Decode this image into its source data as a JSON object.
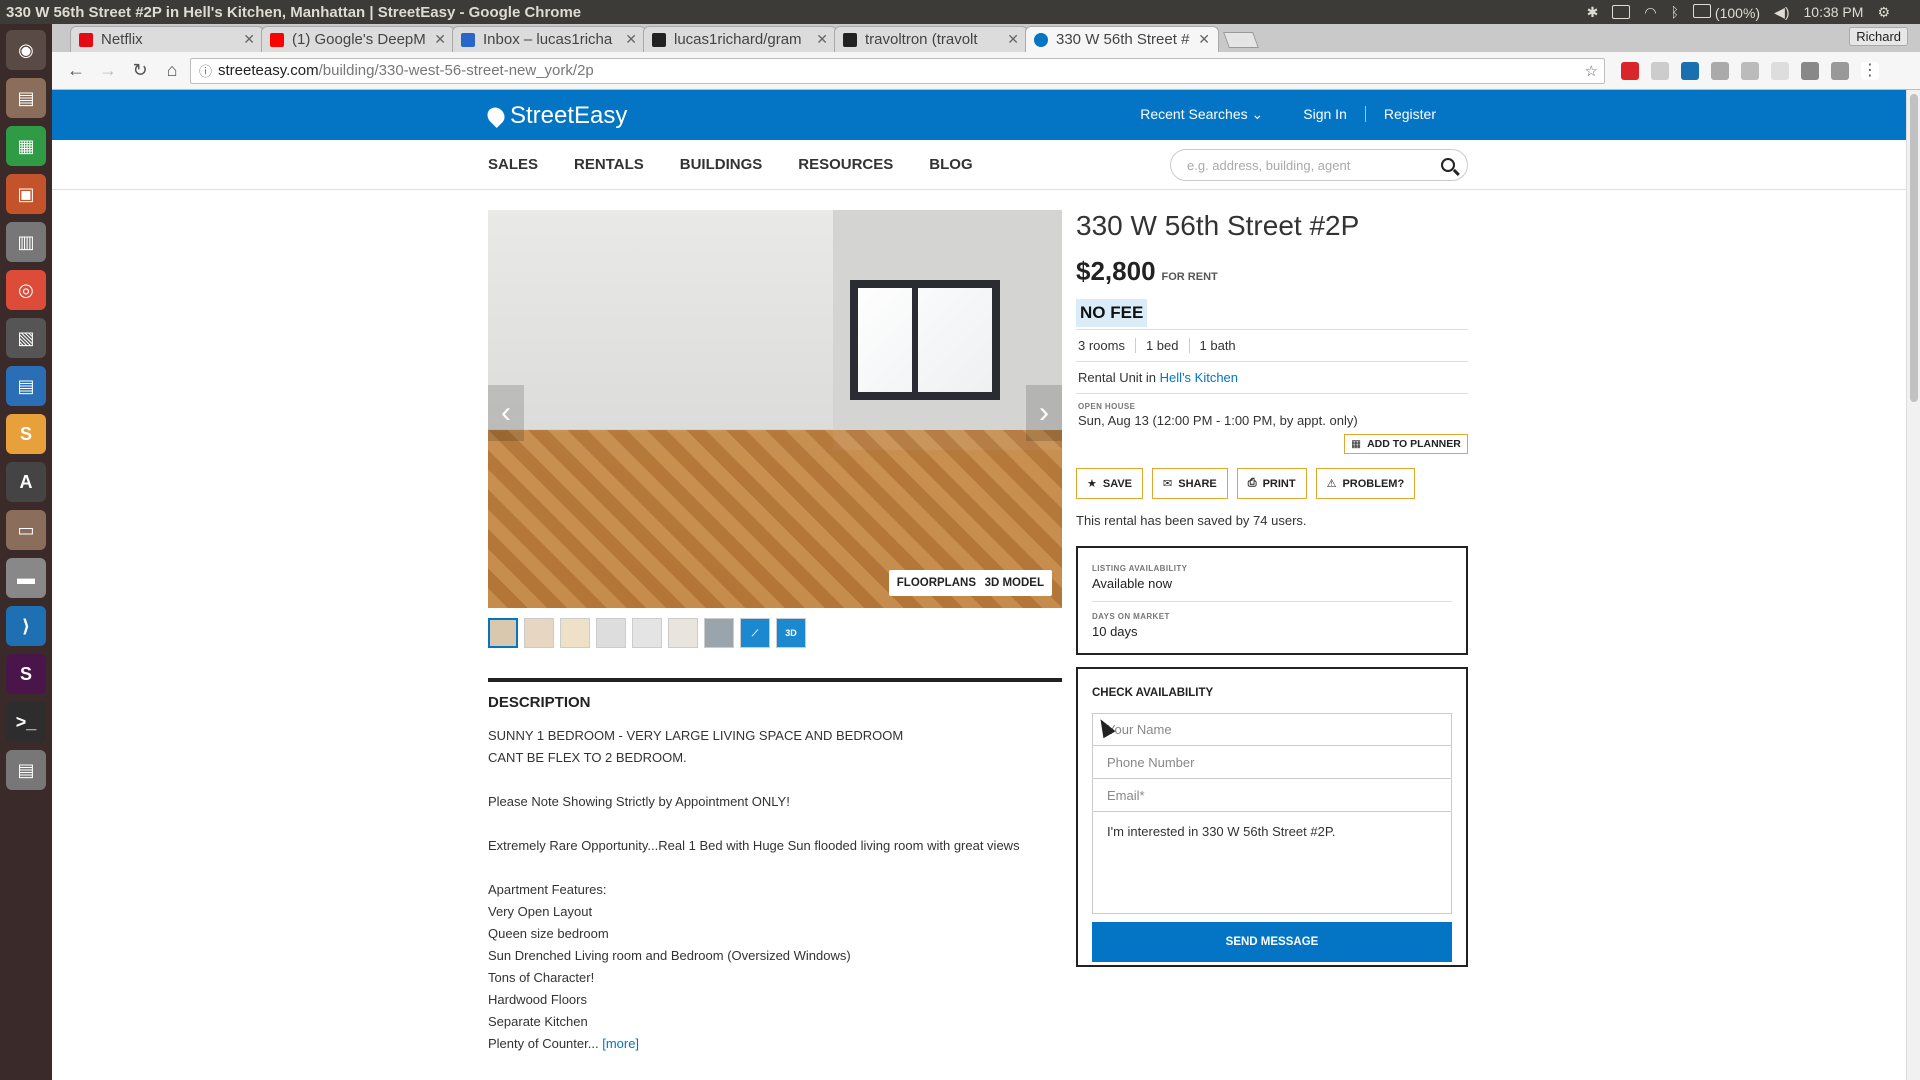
{
  "os": {
    "window_title": "330 W 56th Street #2P in Hell's Kitchen, Manhattan | StreetEasy - Google Chrome",
    "battery": "(100%)",
    "clock": "10:38 PM",
    "user": "Richard"
  },
  "browser": {
    "tabs": [
      {
        "label": "Netflix",
        "color": "#e50914"
      },
      {
        "label": "(1) Google's DeepM",
        "color": "#ff0000"
      },
      {
        "label": "Inbox – lucas1richa",
        "color": "#2a66c9"
      },
      {
        "label": "lucas1richard/gram",
        "color": "#222222"
      },
      {
        "label": "travoltron (travolt",
        "color": "#222222"
      },
      {
        "label": "330 W 56th Street #",
        "color": "#0375c4"
      }
    ],
    "url_host": "streeteasy.com",
    "url_path": "/building/330-west-56-street-new_york/2p"
  },
  "site": {
    "logo": "StreetEasy",
    "recent_searches": "Recent Searches",
    "sign_in": "Sign In",
    "register": "Register",
    "nav": [
      "SALES",
      "RENTALS",
      "BUILDINGS",
      "RESOURCES",
      "BLOG"
    ],
    "search_placeholder": "e.g. address, building, agent"
  },
  "photo": {
    "floorplans": "FLOORPLANS",
    "model_3d": "3D MODEL",
    "thumb_3d": "3D"
  },
  "description": {
    "heading": "DESCRIPTION",
    "line1": "SUNNY 1 BEDROOM - VERY LARGE LIVING SPACE AND BEDROOM",
    "line2": "CANT BE FLEX TO 2 BEDROOM.",
    "line3": "Please Note Showing Strictly by Appointment ONLY!",
    "line4": "Extremely Rare Opportunity...Real 1 Bed with Huge Sun flooded living room with great views",
    "features_title": "Apartment Features:",
    "features": [
      "Very Open Layout",
      "Queen size bedroom",
      "Sun Drenched Living room and Bedroom (Oversized Windows)",
      "Tons of Character!",
      "Hardwood Floors",
      "Separate Kitchen"
    ],
    "last_line": "Plenty of Counter...",
    "more": "[more]"
  },
  "listing": {
    "title": "330 W 56th Street #2P",
    "price": "$2,800",
    "price_tag": "FOR RENT",
    "no_fee": "NO FEE",
    "rooms": "3 rooms",
    "beds": "1 bed",
    "baths": "1 bath",
    "rental_prefix": "Rental Unit in",
    "neighborhood": "Hell's Kitchen",
    "open_house_label": "OPEN HOUSE",
    "open_house_date": "Sun, Aug 13 (12:00 PM - 1:00 PM, by appt. only)",
    "add_to_planner": "ADD TO PLANNER",
    "save": "SAVE",
    "share": "SHARE",
    "print": "PRINT",
    "problem": "PROBLEM?",
    "saved_by": "This rental has been saved by 74 users."
  },
  "availability": {
    "label1": "LISTING AVAILABILITY",
    "value1": "Available now",
    "label2": "DAYS ON MARKET",
    "value2": "10 days"
  },
  "contact": {
    "heading": "CHECK AVAILABILITY",
    "name_placeholder": "Your Name",
    "phone_placeholder": "Phone Number",
    "email_placeholder": "Email*",
    "message": "I'm interested in 330 W 56th Street #2P.",
    "send": "SEND MESSAGE"
  }
}
